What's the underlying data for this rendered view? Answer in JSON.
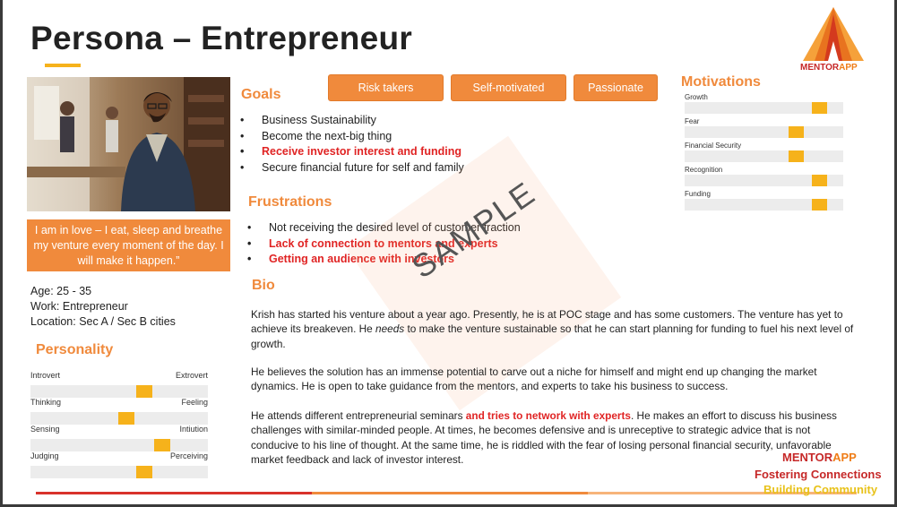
{
  "title": "Persona – Entrepreneur",
  "logo": {
    "part1": "MENTOR",
    "part2": "APP"
  },
  "quote": "I am in love – I eat, sleep and breathe my venture every moment of the day. I will make it happen.”",
  "demographics": {
    "age": "Age: 25 - 35",
    "work": "Work: Entrepreneur",
    "location": "Location: Sec A / Sec B cities"
  },
  "personality": {
    "heading": "Personality",
    "traits": [
      {
        "left": "Introvert",
        "right": "Extrovert",
        "level": 0.64
      },
      {
        "left": "Thinking",
        "right": "Feeling",
        "level": 0.54
      },
      {
        "left": "Sensing",
        "right": "Intiution",
        "level": 0.74
      },
      {
        "left": "Judging",
        "right": "Perceiving",
        "level": 0.64
      }
    ]
  },
  "tags": [
    "Risk takers",
    "Self-motivated",
    "Passionate"
  ],
  "goals": {
    "heading": "Goals",
    "items": [
      {
        "text": "Business Sustainability",
        "highlight": false
      },
      {
        "text": "Become the next-big thing",
        "highlight": false
      },
      {
        "text": "Receive investor interest and funding",
        "highlight": true
      },
      {
        "text": "Secure financial future for self and family",
        "highlight": false
      }
    ]
  },
  "frustrations": {
    "heading": "Frustrations",
    "items": [
      {
        "text": "Not receiving the desired level of customer traction",
        "highlight": false
      },
      {
        "text": "Lack of connection to mentors and experts",
        "highlight": true
      },
      {
        "text": "Getting an audience with investors",
        "highlight": true
      }
    ]
  },
  "motivations": {
    "heading": "Motivations",
    "items": [
      {
        "label": "Growth",
        "level": 0.85
      },
      {
        "label": "Fear",
        "level": 0.7
      },
      {
        "label": "Financial Security",
        "level": 0.7
      },
      {
        "label": "Recognition",
        "level": 0.85
      },
      {
        "label": "Funding",
        "level": 0.85
      }
    ]
  },
  "bio": {
    "heading": "Bio",
    "p1": {
      "a": "Krish has started his venture about a year ago. Presently, he is at POC stage and has some customers. The venture has yet to achieve its breakeven. He ",
      "em": "needs",
      "b": " to make the venture sustainable so that he can start planning for funding to fuel his next level of growth."
    },
    "p2": "He believes the solution has an immense potential to carve out a niche for himself and might end up changing the market dynamics. He is open to take guidance from the mentors, and experts to take his business to success.",
    "p3": {
      "a": "He attends different entrepreneurial seminars ",
      "red": "and tries to network with experts",
      "b": ". He makes an effort to discuss his business challenges with similar-minded people. At times, he becomes defensive and is unreceptive to strategic advice that is not conducive to his line of thought. At the same time, he is riddled with the fear of losing personal financial security, unfavorable market feedback and lack of investor interest."
    }
  },
  "watermark": "SAMPLE",
  "branding": {
    "name1": "MENTOR",
    "name2": "APP",
    "line1": "Fostering Connections",
    "line2": "Building Community"
  },
  "colors": {
    "accent_orange": "#f08a3c",
    "accent_yellow": "#f6b21b",
    "highlight_red": "#e02424",
    "footer_red": "#d8322b"
  }
}
